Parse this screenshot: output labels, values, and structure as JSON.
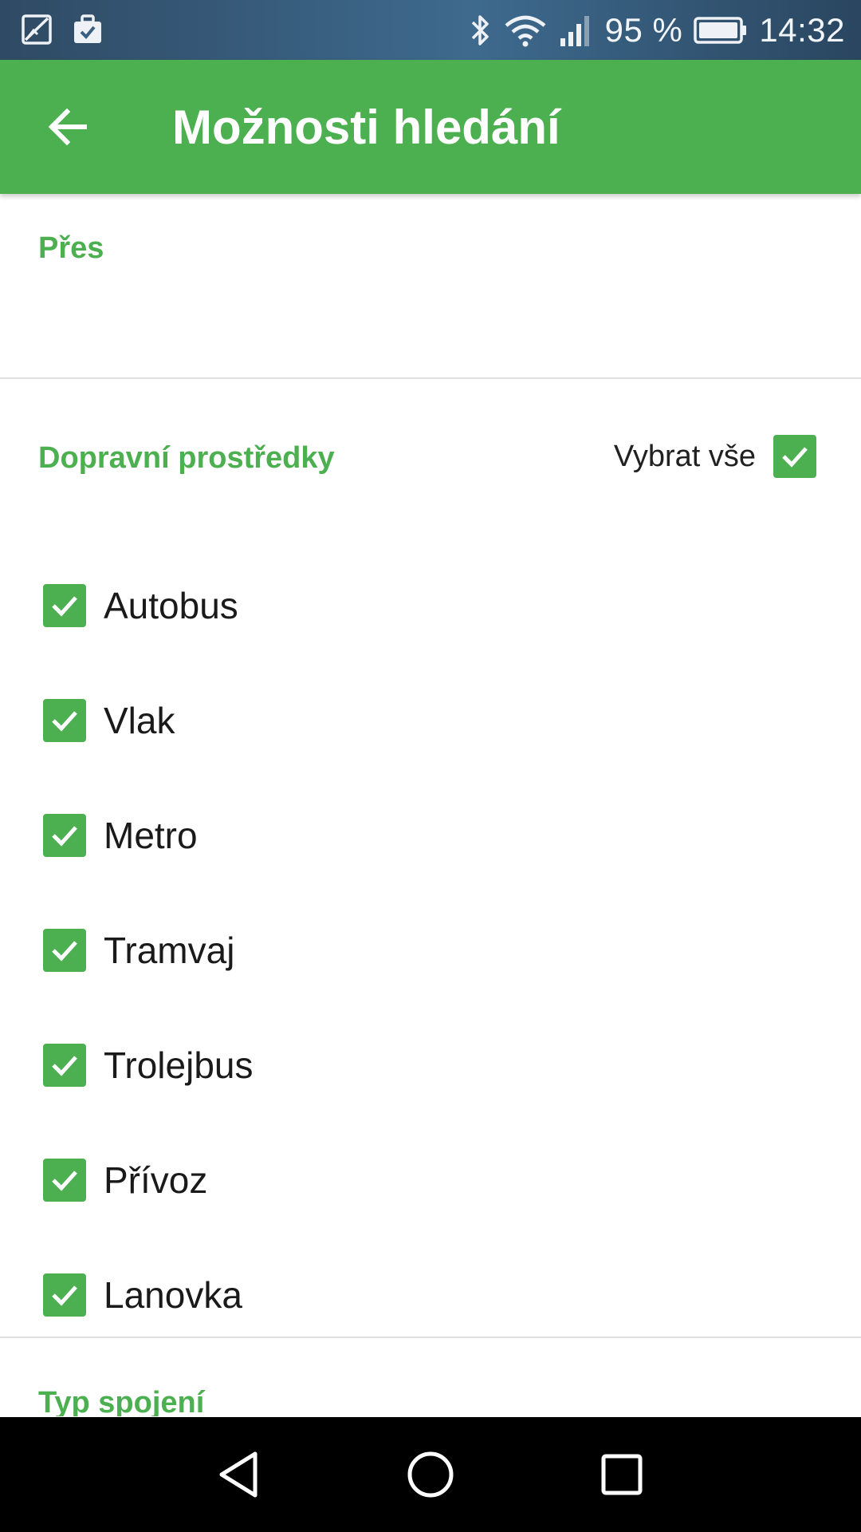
{
  "status_bar": {
    "battery_text": "95 %",
    "time": "14:32",
    "icons": [
      "gallery-icon",
      "briefcase-icon",
      "bluetooth-icon",
      "wifi-icon",
      "signal-icon",
      "battery-icon"
    ]
  },
  "app_bar": {
    "title": "Možnosti hledání",
    "back_icon": "arrow-back-icon",
    "color": "#4caf50"
  },
  "sections": {
    "via": {
      "label": "Přes",
      "value": ""
    },
    "transport": {
      "label": "Dopravní prostředky",
      "select_all_label": "Vybrat vše",
      "select_all_checked": true,
      "items": [
        {
          "label": "Autobus",
          "checked": true
        },
        {
          "label": "Vlak",
          "checked": true
        },
        {
          "label": "Metro",
          "checked": true
        },
        {
          "label": "Tramvaj",
          "checked": true
        },
        {
          "label": "Trolejbus",
          "checked": true
        },
        {
          "label": "Přívoz",
          "checked": true
        },
        {
          "label": "Lanovka",
          "checked": true
        }
      ]
    },
    "connection_type": {
      "label": "Typ spojení"
    }
  },
  "nav_bar": {
    "buttons": [
      "back-triangle-icon",
      "home-circle-icon",
      "recents-square-icon"
    ]
  },
  "colors": {
    "accent": "#4caf50",
    "text": "#1a1a1a",
    "divider": "#e0e0e0",
    "nav_background": "#000000"
  }
}
